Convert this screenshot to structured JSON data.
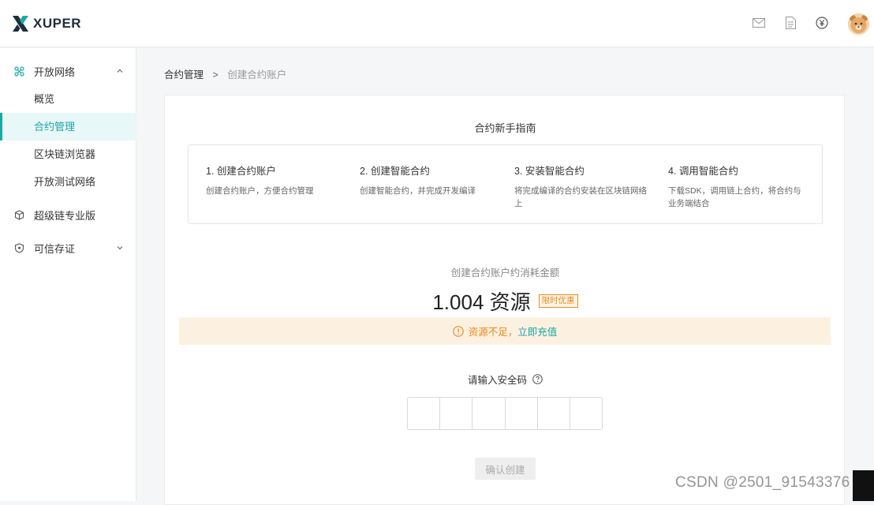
{
  "header": {
    "brand": "XUPER",
    "icons": [
      "mail-icon",
      "document-icon",
      "yuan-coin-icon",
      "user-avatar"
    ]
  },
  "sidebar": {
    "groups": [
      {
        "label": "开放网络",
        "icon": "network-icon",
        "expanded": true,
        "items": [
          {
            "label": "概览",
            "active": false
          },
          {
            "label": "合约管理",
            "active": true
          },
          {
            "label": "区块链浏览器",
            "active": false
          },
          {
            "label": "开放测试网络",
            "active": false
          }
        ]
      },
      {
        "label": "超级链专业版",
        "icon": "cube-icon"
      },
      {
        "label": "可信存证",
        "icon": "shield-icon",
        "expanded": false
      }
    ]
  },
  "breadcrumb": {
    "root": "合约管理",
    "separator": ">",
    "current": "创建合约账户"
  },
  "guide": {
    "title": "合约新手指南",
    "steps": [
      {
        "title": "1. 创建合约账户",
        "desc": "创建合约账户，方便合约管理"
      },
      {
        "title": "2. 创建智能合约",
        "desc": "创建智能合约，并完成开发编译"
      },
      {
        "title": "3. 安装智能合约",
        "desc": "将完成编译的合约安装在区块链网络上"
      },
      {
        "title": "4. 调用智能合约",
        "desc": "下载SDK，调用链上合约，将合约与业务端结合"
      }
    ]
  },
  "cost": {
    "label": "创建合约账户约消耗金额",
    "value": "1.004 资源",
    "badge": "限时优惠"
  },
  "warning": {
    "text": "资源不足，",
    "link": "立即充值"
  },
  "security": {
    "label": "请输入安全码",
    "code_length": 6
  },
  "confirm_label": "确认创建",
  "watermark": "CSDN @2501_91543376",
  "colors": {
    "accent": "#1aa7a7",
    "warning": "#e8891c",
    "warning_bg": "#fcf1e0"
  }
}
